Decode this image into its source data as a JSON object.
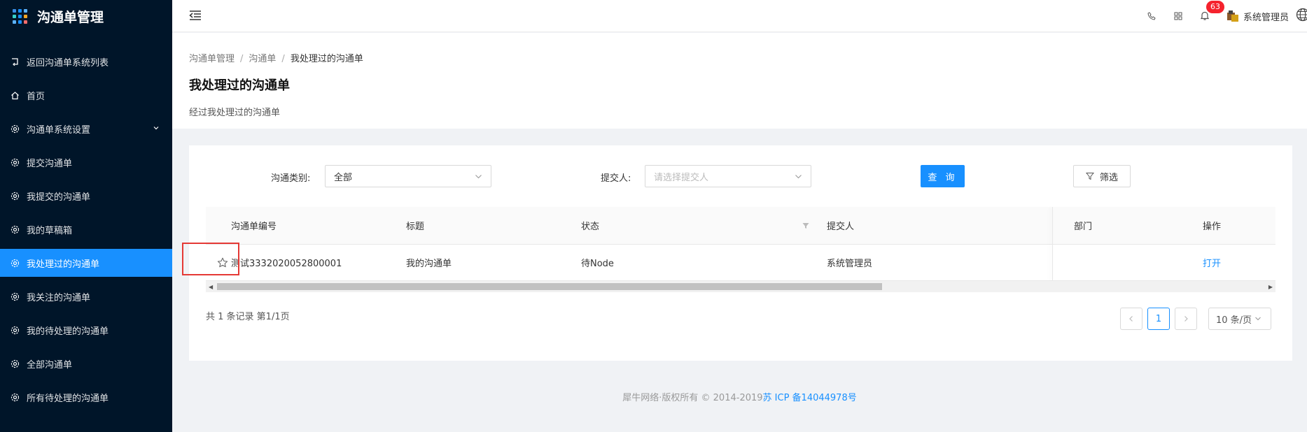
{
  "app": {
    "title": "沟通单管理"
  },
  "sidebar": {
    "items": [
      {
        "label": "返回沟通单系统列表",
        "icon": "return-icon"
      },
      {
        "label": "首页",
        "icon": "home-icon"
      },
      {
        "label": "沟通单系统设置",
        "icon": "gear-icon",
        "expandable": true
      },
      {
        "label": "提交沟通单",
        "icon": "gear-icon"
      },
      {
        "label": "我提交的沟通单",
        "icon": "gear-icon"
      },
      {
        "label": "我的草稿箱",
        "icon": "gear-icon"
      },
      {
        "label": "我处理过的沟通单",
        "icon": "gear-icon",
        "active": true
      },
      {
        "label": "我关注的沟通单",
        "icon": "gear-icon"
      },
      {
        "label": "我的待处理的沟通单",
        "icon": "gear-icon"
      },
      {
        "label": "全部沟通单",
        "icon": "gear-icon"
      },
      {
        "label": "所有待处理的沟通单",
        "icon": "gear-icon"
      }
    ]
  },
  "header": {
    "notification_count": "63",
    "user_name": "系统管理员",
    "icons": [
      "phone-icon",
      "apps-icon",
      "bell-icon",
      "avatar",
      "globe-icon"
    ]
  },
  "page": {
    "breadcrumb": [
      "沟通单管理",
      "沟通单",
      "我处理过的沟通单"
    ],
    "title": "我处理过的沟通单",
    "description": "经过我处理过的沟通单"
  },
  "filters": {
    "category_label": "沟通类别:",
    "category_value": "全部",
    "submitter_label": "提交人:",
    "submitter_placeholder": "请选择提交人",
    "query_button": "查 询",
    "filter_button": "筛选"
  },
  "table": {
    "columns": [
      "沟通单编号",
      "标题",
      "状态",
      "提交人",
      "部门",
      "操作"
    ],
    "rows": [
      {
        "id": "测试3332020052800001",
        "title": "我的沟通单",
        "status": "待Node",
        "submitter": "系统管理员",
        "department": "",
        "action": "打开"
      }
    ]
  },
  "pagination": {
    "summary": "共 1 条记录 第1/1页",
    "current_page": "1",
    "page_size": "10 条/页"
  },
  "footer": {
    "text": "犀牛网络·版权所有 © 2014-2019",
    "icp": "苏 ICP 备14044978号"
  },
  "colors": {
    "sidebar_bg": "#001529",
    "accent": "#1890ff",
    "badge": "#f5222d",
    "highlight": "#e53935"
  }
}
